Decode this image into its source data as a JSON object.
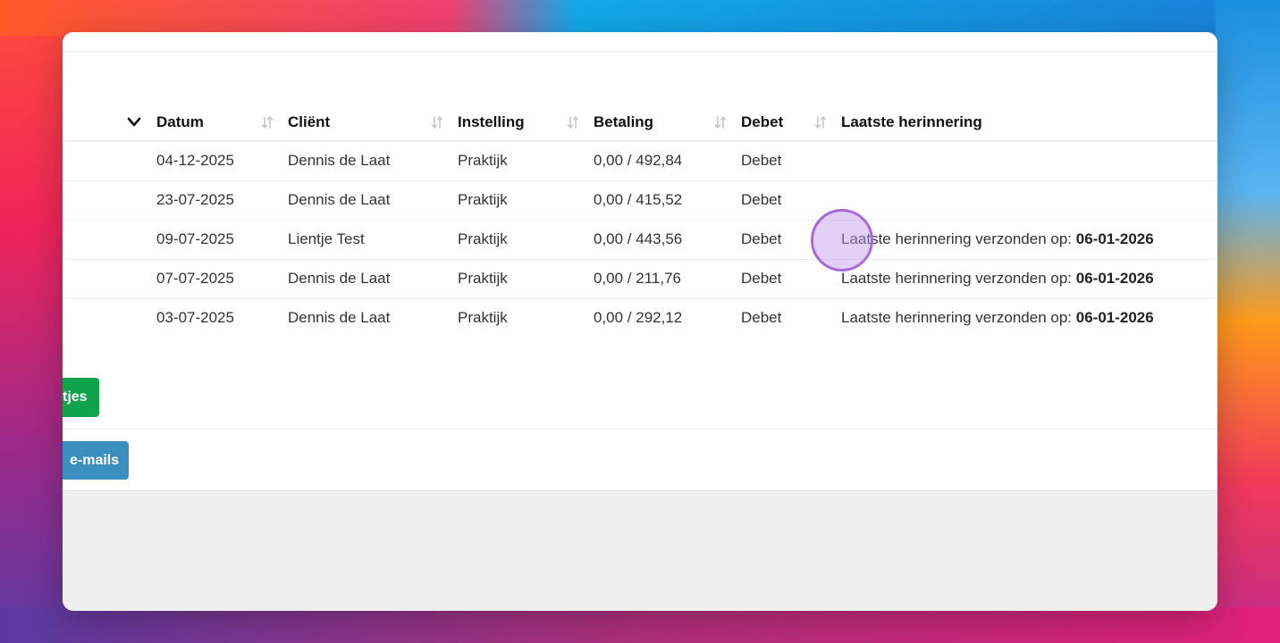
{
  "table": {
    "headers": [
      "Datum",
      "Cliënt",
      "Instelling",
      "Betaling",
      "Debet",
      "Laatste herinnering"
    ],
    "rows": [
      {
        "datum": "04-12-2025",
        "client": "Dennis de Laat",
        "instelling": "Praktijk",
        "betaling": "0,00 / 492,84",
        "debet": "Debet",
        "reminder_text": "",
        "reminder_date": ""
      },
      {
        "datum": "23-07-2025",
        "client": "Dennis de Laat",
        "instelling": "Praktijk",
        "betaling": "0,00 / 415,52",
        "debet": "Debet",
        "reminder_text": "",
        "reminder_date": ""
      },
      {
        "datum": "09-07-2025",
        "client": "Lientje Test",
        "instelling": "Praktijk",
        "betaling": "0,00 / 443,56",
        "debet": "Debet",
        "reminder_text": "Laatste herinnering verzonden op: ",
        "reminder_date": "06-01-2026"
      },
      {
        "datum": "07-07-2025",
        "client": "Dennis de Laat",
        "instelling": "Praktijk",
        "betaling": "0,00 / 211,76",
        "debet": "Debet",
        "reminder_text": "Laatste herinnering verzonden op: ",
        "reminder_date": "06-01-2026"
      },
      {
        "datum": "03-07-2025",
        "client": "Dennis de Laat",
        "instelling": "Praktijk",
        "betaling": "0,00 / 292,12",
        "debet": "Debet",
        "reminder_text": "Laatste herinnering verzonden op: ",
        "reminder_date": "06-01-2026"
      }
    ]
  },
  "buttons": {
    "green_label": "tjes",
    "blue_label": "e-mails"
  },
  "icons": {
    "expand": "chevron-down-icon",
    "sort": "sort-arrows-icon"
  },
  "colors": {
    "green_button": "#11a24c",
    "blue_button": "#3a8fbf",
    "cursor_highlight": "#a86ad8"
  }
}
